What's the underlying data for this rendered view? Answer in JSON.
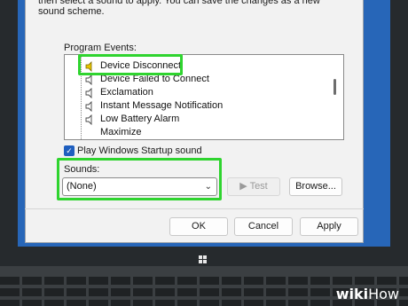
{
  "dialog": {
    "intro_text": "then select a sound to apply.  You can save the changes as a new sound scheme.",
    "program_events_label": "Program Events:",
    "events": [
      {
        "label": "Device Disconnect",
        "icon": "speaker-icon",
        "highlighted": true
      },
      {
        "label": "Device Failed to Connect",
        "icon": "speaker-icon"
      },
      {
        "label": "Exclamation",
        "icon": "speaker-icon"
      },
      {
        "label": "Instant Message Notification",
        "icon": "speaker-icon"
      },
      {
        "label": "Low Battery Alarm",
        "icon": "speaker-icon"
      },
      {
        "label": "Maximize",
        "icon": "none"
      }
    ],
    "startup_checkbox": {
      "label": "Play Windows Startup sound",
      "checked": true
    },
    "sounds_label": "Sounds:",
    "sounds_select": {
      "value": "(None)"
    },
    "test_button": {
      "label": "▶ Test",
      "enabled": false
    },
    "browse_button": {
      "label": "Browse..."
    },
    "ok_button": {
      "label": "OK"
    },
    "cancel_button": {
      "label": "Cancel"
    },
    "apply_button": {
      "label": "Apply"
    }
  },
  "branding": {
    "text_bold": "wiki",
    "text_regular": "How"
  },
  "colors": {
    "highlight": "#2fd42f",
    "desktop": "#2766b8",
    "dialog_bg": "#f2f2f2",
    "checkbox": "#1f5fbf"
  }
}
